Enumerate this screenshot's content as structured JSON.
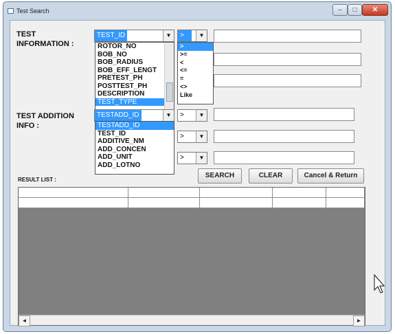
{
  "window": {
    "title": "Test Search",
    "min_icon": "minimize-icon",
    "max_icon": "maximize-icon",
    "close_icon": "close-icon"
  },
  "test_info": {
    "label_line1": "TEST",
    "label_line2": "INFORMATION :",
    "field_selected": "TEST_ID",
    "operator_selected": ">",
    "field_options": [
      "ROTOR_NO",
      "BOB_NO",
      "BOB_RADIUS",
      "BOB_EFF_LENGT",
      "PRETEST_PH",
      "POSTTEST_PH",
      "DESCRIPTION",
      "TEST_TYPE"
    ],
    "field_highlighted": "TEST_TYPE",
    "operator_options": [
      ">",
      ">=",
      "<",
      "<=",
      "=",
      "<>",
      "Like"
    ],
    "operator_highlighted": ">"
  },
  "test_addition": {
    "label_line1": "TEST ADDITION",
    "label_line2": "INFO :",
    "field_selected": "TESTADD_ID",
    "operator_1": ">",
    "operator_2": ">",
    "operator_3": ">",
    "field_options": [
      "TESTADD_ID",
      "TEST_ID",
      "ADDITIVE_NM",
      "ADD_CONCEN",
      "ADD_UNIT",
      "ADD_LOTNO"
    ],
    "field_highlighted": "TESTADD_ID"
  },
  "buttons": {
    "search": "SEARCH",
    "clear": "CLEAR",
    "cancel": "Cancel & Return"
  },
  "result_list": {
    "label": "RESULT LIST :"
  },
  "scroll": {
    "left_arrow": "◄",
    "right_arrow": "►"
  },
  "icons": {
    "dropdown": "▼"
  }
}
